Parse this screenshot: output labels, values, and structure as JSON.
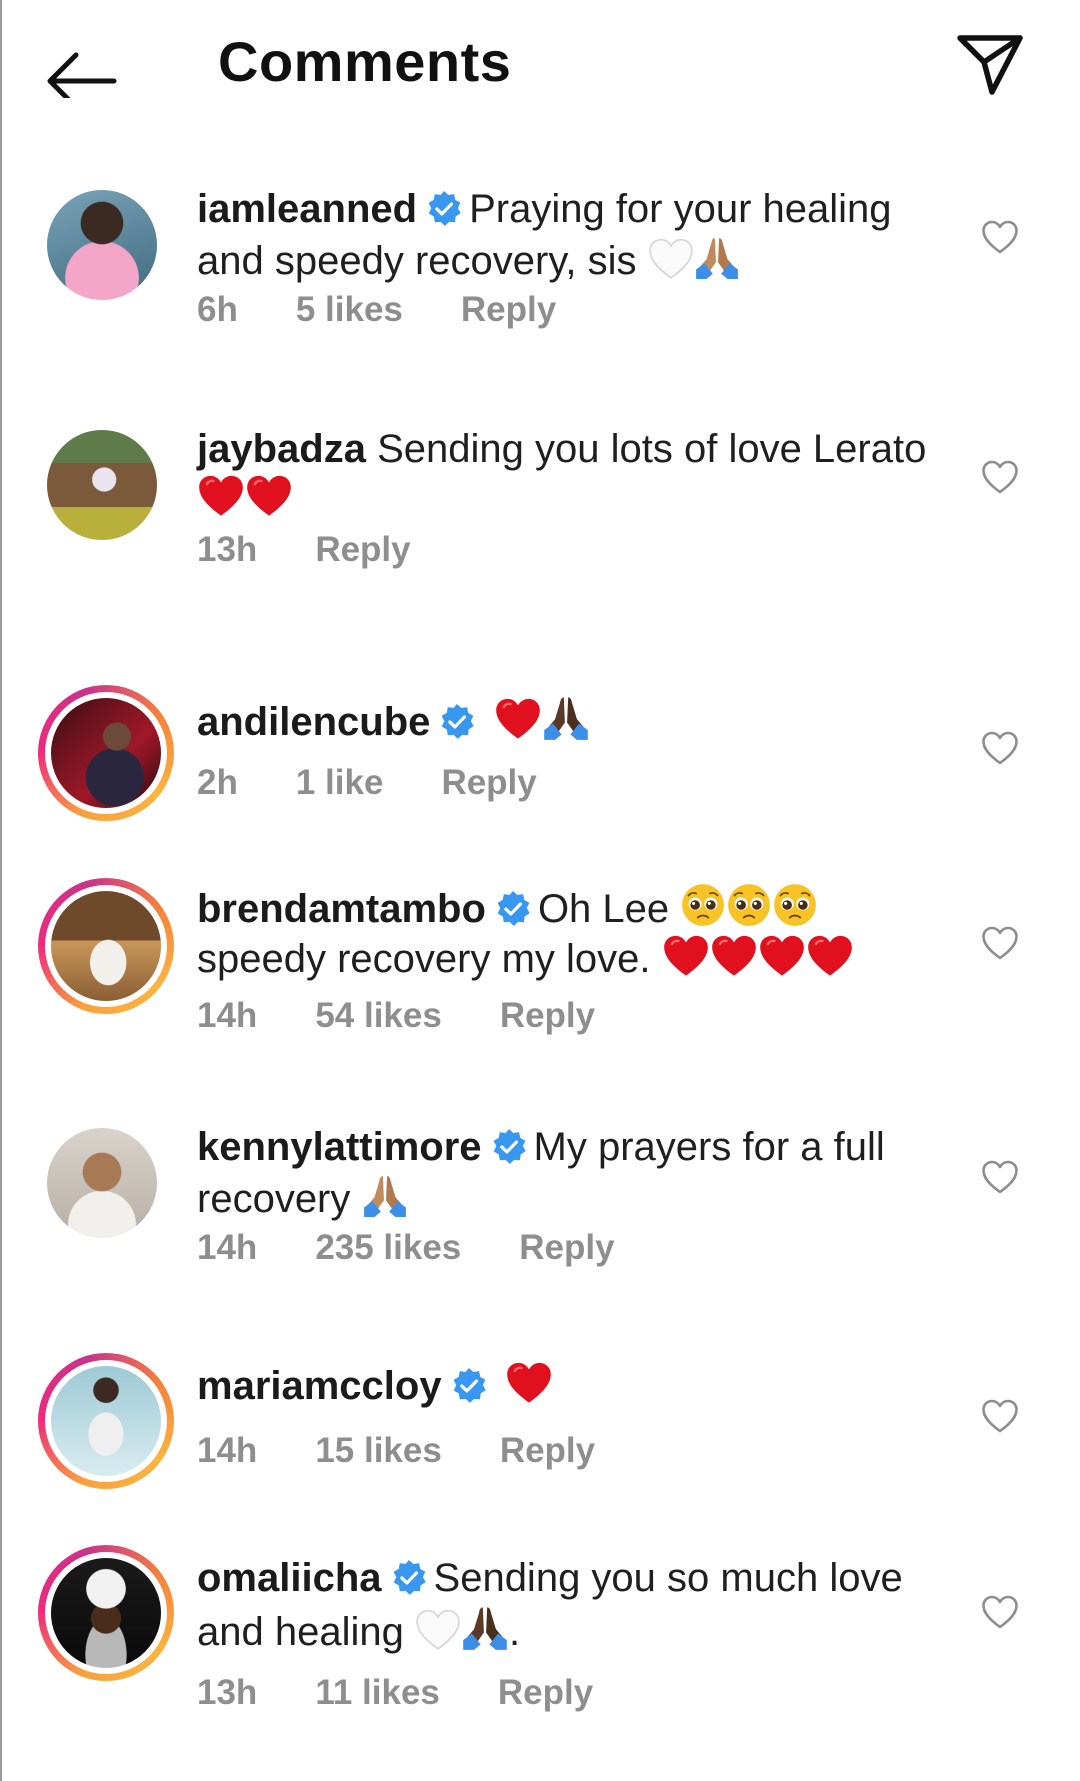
{
  "header": {
    "title": "Comments"
  },
  "comments": [
    {
      "username": "iamleanned",
      "verified": true,
      "text": "Praying for your healing and speedy recovery, sis",
      "emojis": "white-heart folded-hands",
      "time": "6h",
      "likes": "5 likes",
      "reply": "Reply"
    },
    {
      "username": "jaybadza",
      "verified": false,
      "text": "Sending you lots of love Lerato",
      "emojis": "red-heart red-heart",
      "time": "13h",
      "likes": "",
      "reply": "Reply"
    },
    {
      "username": "andilencube",
      "verified": true,
      "text": "",
      "emojis": "red-heart folded-hands",
      "time": "2h",
      "likes": "1 like",
      "reply": "Reply"
    },
    {
      "username": "brendamtambo",
      "verified": true,
      "text": "Oh Lee",
      "text2": "speedy recovery my love.",
      "emojis": "pleading-face x3, red-heart x4",
      "time": "14h",
      "likes": "54 likes",
      "reply": "Reply"
    },
    {
      "username": "kennylattimore",
      "verified": true,
      "text": "My prayers for a full recovery",
      "emojis": "folded-hands",
      "time": "14h",
      "likes": "235 likes",
      "reply": "Reply"
    },
    {
      "username": "mariamccloy",
      "verified": true,
      "text": "",
      "emojis": "red-heart",
      "time": "14h",
      "likes": "15 likes",
      "reply": "Reply"
    },
    {
      "username": "omaliicha",
      "verified": true,
      "text": "Sending you so much love and healing",
      "text_suffix": ".",
      "emojis": "white-heart folded-hands",
      "time": "13h",
      "likes": "11 likes",
      "reply": "Reply"
    }
  ],
  "colors": {
    "verified": "#3897f0",
    "meta": "#8e8e8e",
    "heart_red": "#e0101e"
  }
}
